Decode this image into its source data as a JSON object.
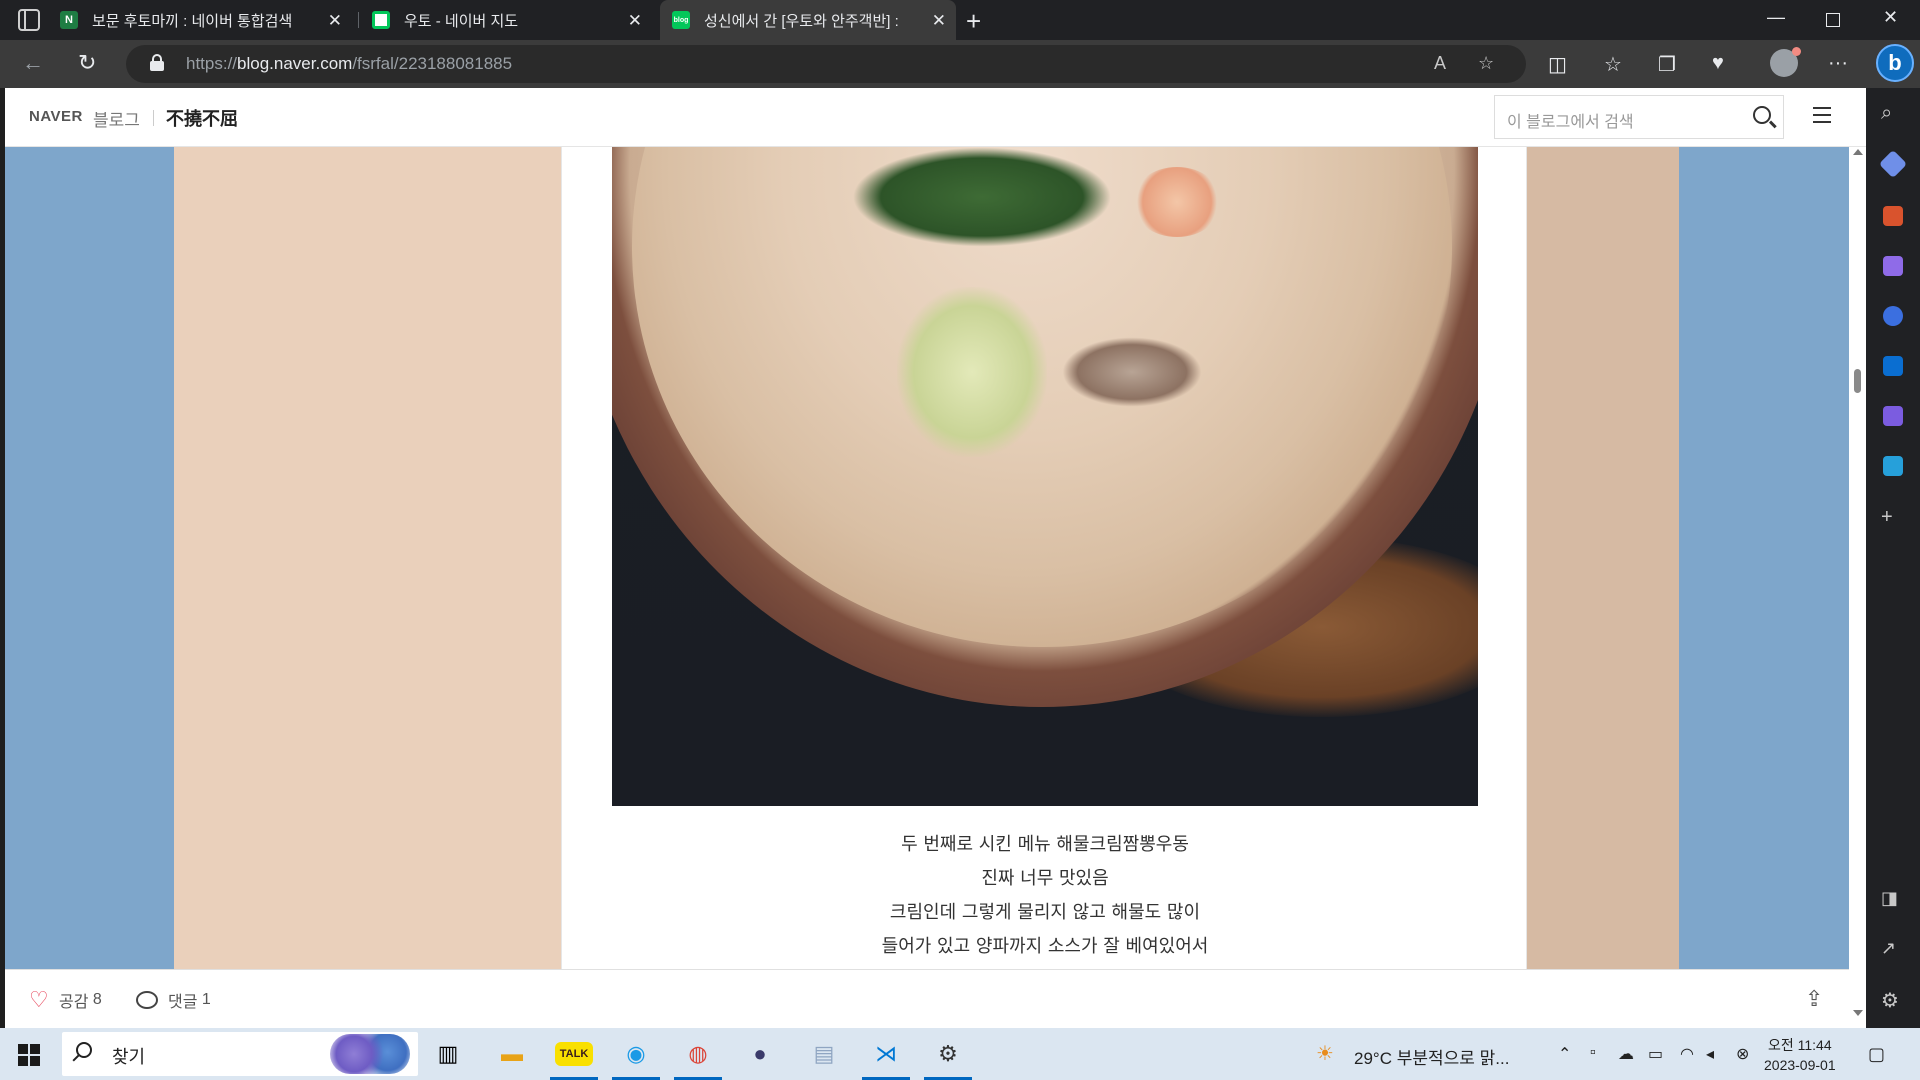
{
  "tabs": [
    {
      "favicon": "N",
      "title": "보문 후토마끼 : 네이버 통합검색",
      "color": "#2db400"
    },
    {
      "favicon": "map",
      "title": "우토 - 네이버 지도",
      "color": "#03c75a"
    },
    {
      "favicon": "blog",
      "title": "성신에서 간 [우토와 안주객반] : ",
      "color": "#03c75a"
    }
  ],
  "address": {
    "protocol": "https://",
    "host": "blog.naver.com",
    "path": "/fsrfal/223188081885"
  },
  "blog": {
    "naver": "NAVER",
    "label": "블로그",
    "name": "不撓不屈",
    "search_placeholder": "이 블로그에서 검색"
  },
  "post": {
    "caption": [
      "두 번째로 시킨 메뉴 해물크림짬뽕우동",
      "진짜 너무 맛있음",
      "크림인데 그렇게 물리지 않고 해물도 많이",
      "들어가 있고 양파까지 소스가 잘 베여있어서"
    ],
    "like_label": "공감",
    "like_count": "8",
    "comment_label": "댓글",
    "comment_count": "1"
  },
  "taskbar": {
    "search_label": "찾기",
    "weather": "29°C  부분적으로 맑...",
    "time": "오전 11:44",
    "date": "2023-09-01"
  },
  "colors": {
    "bg_blue": "#7ea6cb",
    "bg_beige": "#ead0bb",
    "accent": "#0067c0"
  }
}
